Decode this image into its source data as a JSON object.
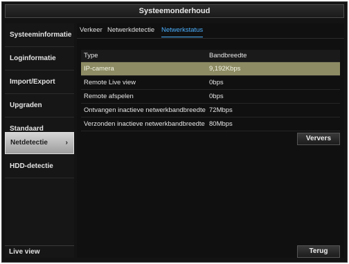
{
  "window": {
    "title": "Systeemonderhoud"
  },
  "sidebar": {
    "items": [
      {
        "label": "Systeeminformatie"
      },
      {
        "label": "Loginformatie"
      },
      {
        "label": "Import/Export"
      },
      {
        "label": "Upgraden"
      },
      {
        "label": "Standaard"
      },
      {
        "label": "Netdetectie",
        "active": true,
        "chevron": "›"
      },
      {
        "label": "HDD-detectie"
      }
    ],
    "live_view": "Live view"
  },
  "tabs": [
    {
      "label": "Verkeer"
    },
    {
      "label": "Netwerkdetectie"
    },
    {
      "label": "Netwerkstatus",
      "active": true
    }
  ],
  "table": {
    "columns": [
      "Type",
      "Bandbreedte"
    ],
    "rows": [
      {
        "type": "IP-camera",
        "bandwidth": "9,192Kbps",
        "selected": true
      },
      {
        "type": "Remote Live view",
        "bandwidth": "0bps"
      },
      {
        "type": "Remote afspelen",
        "bandwidth": "0bps"
      },
      {
        "type": "Ontvangen inactieve netwerkbandbreedte",
        "bandwidth": "72Mbps"
      },
      {
        "type": "Verzonden inactieve netwerkbandbreedte",
        "bandwidth": "80Mbps"
      }
    ]
  },
  "buttons": {
    "refresh": "Ververs",
    "back": "Terug"
  },
  "colors": {
    "accent": "#4db1ff",
    "selected_row": "#8c8b63",
    "background": "#131313"
  }
}
